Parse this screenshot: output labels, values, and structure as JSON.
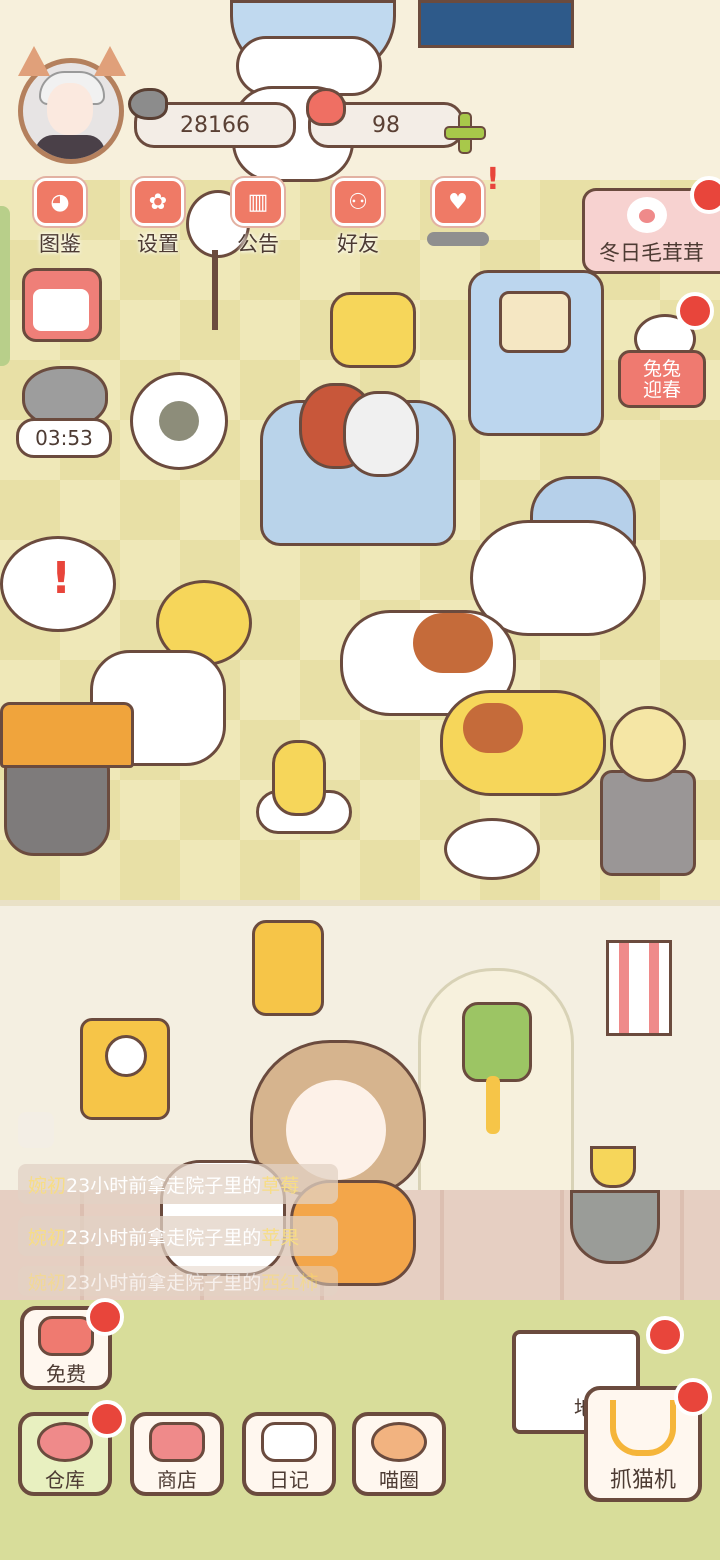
{
  "currency": {
    "coins": "28166",
    "hearts": "98"
  },
  "top_menu": [
    {
      "label": "图鉴",
      "icon": "cat-face-icon"
    },
    {
      "label": "设置",
      "icon": "gear-icon"
    },
    {
      "label": "公告",
      "icon": "gift-icon"
    },
    {
      "label": "好友",
      "icon": "friends-icon"
    },
    {
      "label": "",
      "icon": "hearts-icon"
    }
  ],
  "event_banner": {
    "label": "冬日毛茸茸"
  },
  "rabbit_event": {
    "label_line1": "兔兔",
    "label_line2": "迎春"
  },
  "timer": {
    "value": "03:53"
  },
  "chat": [
    {
      "name": "婉初",
      "text": "23小时前拿走院子里的",
      "item": "草莓"
    },
    {
      "name": "婉初",
      "text": "23小时前拿走院子里的",
      "item": "苹果"
    },
    {
      "name": "婉初",
      "text": "23小时前拿走院子里的",
      "item": "西红柿"
    }
  ],
  "bottom": {
    "free": "免费",
    "warehouse": "仓库",
    "shop": "商店",
    "diary": "日记",
    "circle": "喵圈",
    "claw": "抓猫机",
    "sign": "地"
  },
  "colors": {
    "accent": "#ef7a66",
    "notify": "#e8453b",
    "outline": "#6b4b3e"
  }
}
